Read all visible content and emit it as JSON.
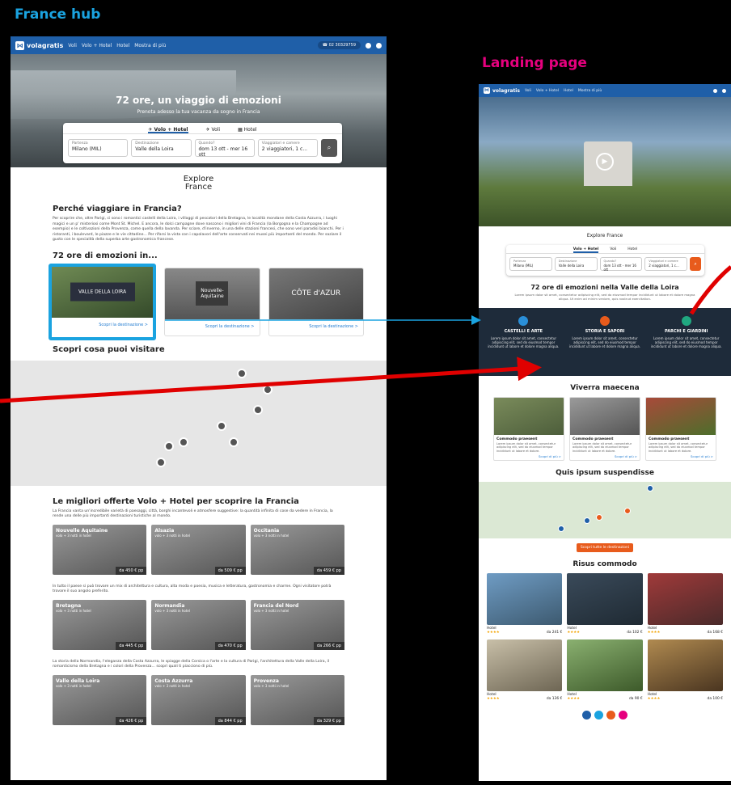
{
  "labels": {
    "hub": "France hub",
    "landing": "Landing page"
  },
  "colors": {
    "hub_label": "#1aa3e0",
    "landing_label": "#e6007e",
    "highlight": "#1aa3e0",
    "arrow": "#e00000",
    "brand": "#1f5fa8"
  },
  "nav": {
    "brand": "volagratis",
    "items": [
      "Voli",
      "Volo + Hotel",
      "Hotel",
      "Mostra di più"
    ],
    "phone": "02 30329759"
  },
  "hub": {
    "hero_title": "72 ore, un viaggio di emozioni",
    "hero_sub": "Prenota adesso la tua vacanza da sogno in Francia",
    "tabs": [
      "Volo + Hotel",
      "Voli",
      "Hotel"
    ],
    "fields": [
      {
        "label": "Partenza",
        "value": "Milano (MIL)"
      },
      {
        "label": "Destinazione",
        "value": "Valle della Loira"
      },
      {
        "label": "Quando?",
        "value": "dom 13 ott - mer 16 ott"
      },
      {
        "label": "Viaggiatori e camere",
        "value": "2 viaggiatori, 1 c..."
      }
    ],
    "explore_logo": [
      "Explore",
      "France"
    ],
    "why_title": "Perché viaggiare in Francia?",
    "why_text": "Per scoprire che, oltre Parigi, ci sono i romantici castelli della Loira, i villaggi di pescatori della Bretagna, le località mondane della Costa Azzurra, i luoghi magici e un p' misteriosi come Mont St. Michel. E ancora, le dolci campagne dove nascono i migliori vini di Francia (la Borgogna e la Champagne ad esempio) e le coltivazioni della Provenza, come quella della lavanda. Per sciare, d'inverno, in una delle stazioni francesi, che sono veri paradisi bianchi. Per i ristoranti, i boulevard, le piazze e le vie cittadine... Per rifarsi la vista con i capolavori dell'arte conservati nei musei più importanti del mondo. Per saziare il gusto con le specialità della superba arte gastronomica francese.",
    "emotions_title": "72 ore di emozioni in...",
    "destinations": [
      {
        "badge": "VALLE DELLA LOIRA",
        "link": "Scopri la destinazione >"
      },
      {
        "badge": "Nouvelle-Aquitaine",
        "link": "Scopri la destinazione >"
      },
      {
        "badge": "CÔTE d'AZUR",
        "link": "Scopri la destinazione >"
      }
    ],
    "visit_title": "Scopri cosa puoi visitare",
    "offers_title": "Le migliori offerte Volo + Hotel per scoprire la Francia",
    "offers_text_1": "La Francia vanta un'incredibile varietà di paesaggi, città, borghi incantevoli e atmosfere suggestive: la quantità infinita di cose da vedere in Francia, la rende una delle più importanti destinazioni turistiche al mondo.",
    "offers_text_2": "In tutto il paese si può trovare un mix di architettura e cultura, alta moda e poesia, musica e letteratura, gastronomia e charme. Ogni visitatore potrà trovare il suo angolo preferito.",
    "offers_text_3": "La storia della Normandia, l'eleganza della Costa Azzurra, le spiagge della Corsica o l'arte e la cultura di Parigi, l'architettura della Valle della Loira, il romanticismo della Bretagna e i colori della Provenza... scopri quali ti piacciono di più.",
    "offers_row1": [
      {
        "name": "Nouvelle Aquitaine",
        "sub": "volo + 3 notti in hotel",
        "price": "da 450 € pp"
      },
      {
        "name": "Alsazia",
        "sub": "volo + 3 notti in hotel",
        "price": "da 509 € pp"
      },
      {
        "name": "Occitania",
        "sub": "volo + 3 notti in hotel",
        "price": "da 459 € pp"
      }
    ],
    "offers_row2": [
      {
        "name": "Bretagna",
        "sub": "volo + 3 notti in hotel",
        "price": "da 445 € pp"
      },
      {
        "name": "Normandia",
        "sub": "volo + 3 notti in hotel",
        "price": "da 470 € pp"
      },
      {
        "name": "Francia del Nord",
        "sub": "volo + 3 notti in hotel",
        "price": "da 266 € pp"
      }
    ],
    "offers_row3": [
      {
        "name": "Valle della Loira",
        "sub": "volo + 3 notti in hotel",
        "price": "da 426 € pp"
      },
      {
        "name": "Costa Azzurra",
        "sub": "volo + 3 notti in hotel",
        "price": "da 844 € pp"
      },
      {
        "name": "Provenza",
        "sub": "volo + 3 notti in hotel",
        "price": "da 329 € pp"
      }
    ]
  },
  "landing": {
    "tabs": [
      "Volo + Hotel",
      "Voli",
      "Hotel"
    ],
    "fields": [
      {
        "label": "Partenza",
        "value": "Milano (MIL)"
      },
      {
        "label": "Destinazione",
        "value": "Valle della Loira"
      },
      {
        "label": "Quando?",
        "value": "dom 13 ott - mer 16 ott"
      },
      {
        "label": "Viaggiatori e camere",
        "value": "2 viaggiatori, 1 c..."
      }
    ],
    "explore_logo": "Explore France",
    "title": "72 ore di emozioni nella Valle della Loira",
    "intro": "Lorem ipsum dolor sit amet, consectetur adipiscing elit, sed do eiusmod tempor incididunt ut labore et dolore magna aliqua. Ut enim ad minim veniam, quis nostrud exercitation.",
    "band": [
      {
        "title": "CASTELLI E ARTE",
        "text": "Lorem ipsum dolor sit amet, consectetur adipiscing elit, sed do eiusmod tempor incididunt ut labore et dolore magna aliqua.",
        "color": "#2a8fd8"
      },
      {
        "title": "STORIA E SAPORI",
        "text": "Lorem ipsum dolor sit amet, consectetur adipiscing elit, sed do eiusmod tempor incididunt ut labore et dolore magna aliqua.",
        "color": "#e85b1c"
      },
      {
        "title": "PARCHI E GIARDINI",
        "text": "Lorem ipsum dolor sit amet, consectetur adipiscing elit, sed do eiusmod tempor incididunt ut labore et dolore magna aliqua.",
        "color": "#20a880"
      }
    ],
    "section1": "Viverra maecena",
    "cards": [
      {
        "title": "Commodo praesent",
        "text": "Lorem ipsum dolor sit amet, consectetur adipiscing elit, sed do eiusmod tempor incididunt ut labore et dolore.",
        "link": "Scopri di più >"
      },
      {
        "title": "Commodo praesent",
        "text": "Lorem ipsum dolor sit amet, consectetur adipiscing elit, sed do eiusmod tempor incididunt ut labore et dolore.",
        "link": "Scopri di più >"
      },
      {
        "title": "Commodo praesent",
        "text": "Lorem ipsum dolor sit amet, consectetur adipiscing elit, sed do eiusmod tempor incididunt ut labore et dolore.",
        "link": "Scopri di più >"
      }
    ],
    "section2": "Quis ipsum suspendisse",
    "cta": "Scopri tutte le destinazioni",
    "section3": "Risus commodo",
    "hotels": [
      {
        "name": "Hotel",
        "price": "da 241 €"
      },
      {
        "name": "Hotel",
        "price": "da 102 €"
      },
      {
        "name": "Hotel",
        "price": "da 168 €"
      },
      {
        "name": "Hotel",
        "price": "da 136 €"
      },
      {
        "name": "Hotel",
        "price": "da 90 €"
      },
      {
        "name": "Hotel",
        "price": "da 100 €"
      }
    ],
    "social_colors": [
      "#1f5fa8",
      "#1aa3e0",
      "#e85b1c",
      "#e6007e"
    ]
  }
}
